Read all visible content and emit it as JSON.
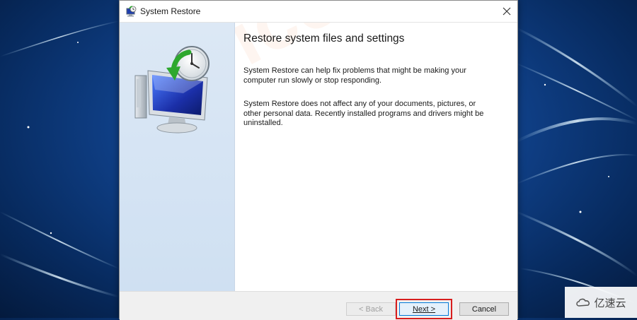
{
  "window": {
    "title": "System Restore",
    "close_glyph": "✕"
  },
  "content": {
    "heading": "Restore system files and settings",
    "paragraph1": "System Restore can help fix problems that might be making your computer run slowly or stop responding.",
    "paragraph2": "System Restore does not affect any of your documents, pictures, or other personal data. Recently installed programs and drivers might be uninstalled.",
    "watermark_text": "DeviceTricks"
  },
  "footer": {
    "back_label": "< Back",
    "next_label": "Next >",
    "cancel_label": "Cancel",
    "highlight_color": "#d81e1e"
  },
  "corner_logo": {
    "text": "亿速云"
  },
  "icons": {
    "title": "system-restore-icon",
    "hero": "system-restore-hero-icon",
    "close": "close-icon"
  }
}
